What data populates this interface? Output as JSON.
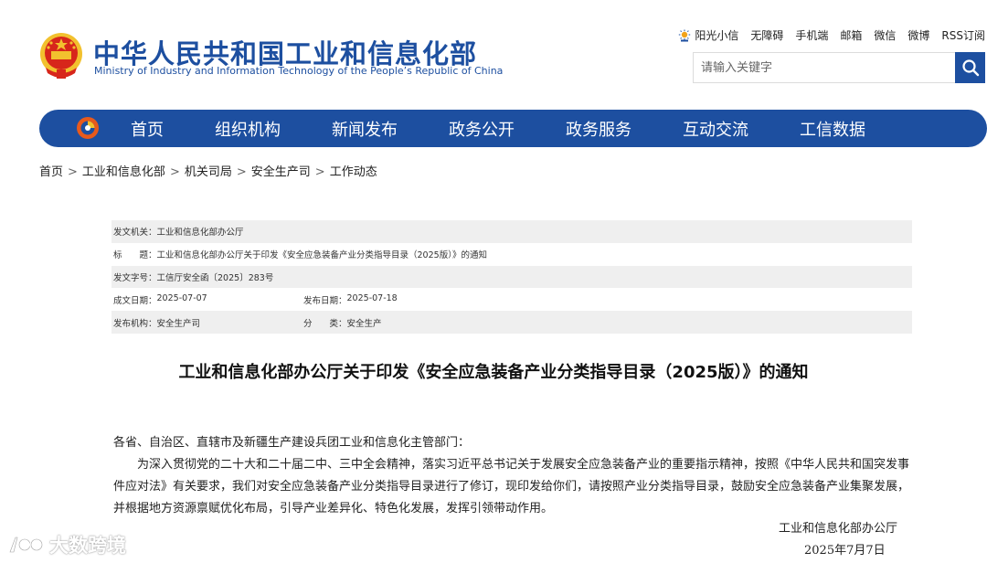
{
  "header": {
    "title_cn": "中华人民共和国工业和信息化部",
    "title_en": "Ministry of Industry and Information Technology of the People’s Republic of China",
    "top_links": [
      "阳光小信",
      "无障碍",
      "手机端",
      "邮箱",
      "微信",
      "微博",
      "RSS订阅"
    ],
    "search_placeholder": "请输入关键字"
  },
  "nav": {
    "items": [
      "首页",
      "组织机构",
      "新闻发布",
      "政务公开",
      "政务服务",
      "互动交流",
      "工信数据"
    ]
  },
  "breadcrumb": {
    "items": [
      "首页",
      "工业和信息化部",
      "机关司局",
      "安全生产司",
      "工作动态"
    ],
    "separator": ">"
  },
  "meta": {
    "issuer_label": "发文机关：",
    "issuer": "工业和信息化部办公厅",
    "title_label": "标　　题：",
    "title": "工业和信息化部办公厅关于印发《安全应急装备产业分类指导目录（2025版）》的通知",
    "doc_no_label": "发文字号：",
    "doc_no": "工信厅安全函〔2025〕283号",
    "created_label": "成文日期：",
    "created": "2025-07-07",
    "published_label": "发布日期：",
    "published": "2025-07-18",
    "org_label": "发布机构：",
    "org": "安全生产司",
    "category_label": "分　　类：",
    "category": "安全生产"
  },
  "document": {
    "title": "工业和信息化部办公厅关于印发《安全应急装备产业分类指导目录（2025版）》的通知",
    "salutation": "各省、自治区、直辖市及新疆生产建设兵团工业和信息化主管部门：",
    "paragraph": "为深入贯彻党的二十大和二十届二中、三中全会精神，落实习近平总书记关于发展安全应急装备产业的重要指示精神，按照《中华人民共和国突发事件应对法》有关要求，我们对安全应急装备产业分类指导目录进行了修订，现印发给你们，请按照产业分类指导目录，鼓励安全应急装备产业集聚发展，并根据地方资源禀赋优化布局，引导产业差异化、特色化发展，发挥引领带动作用。",
    "signature": "工业和信息化部办公厅",
    "date": "2025年7月7日"
  },
  "watermark": "大数跨境",
  "colors": {
    "brand_blue": "#1d4fa0",
    "meta_gray": "#efefef",
    "emblem_red": "#d7261b",
    "emblem_gold": "#f2c12e"
  },
  "icons": [
    "national-emblem-icon",
    "sun-icon",
    "search-icon",
    "mitt-logo-icon",
    "watermark-logo-icon"
  ]
}
